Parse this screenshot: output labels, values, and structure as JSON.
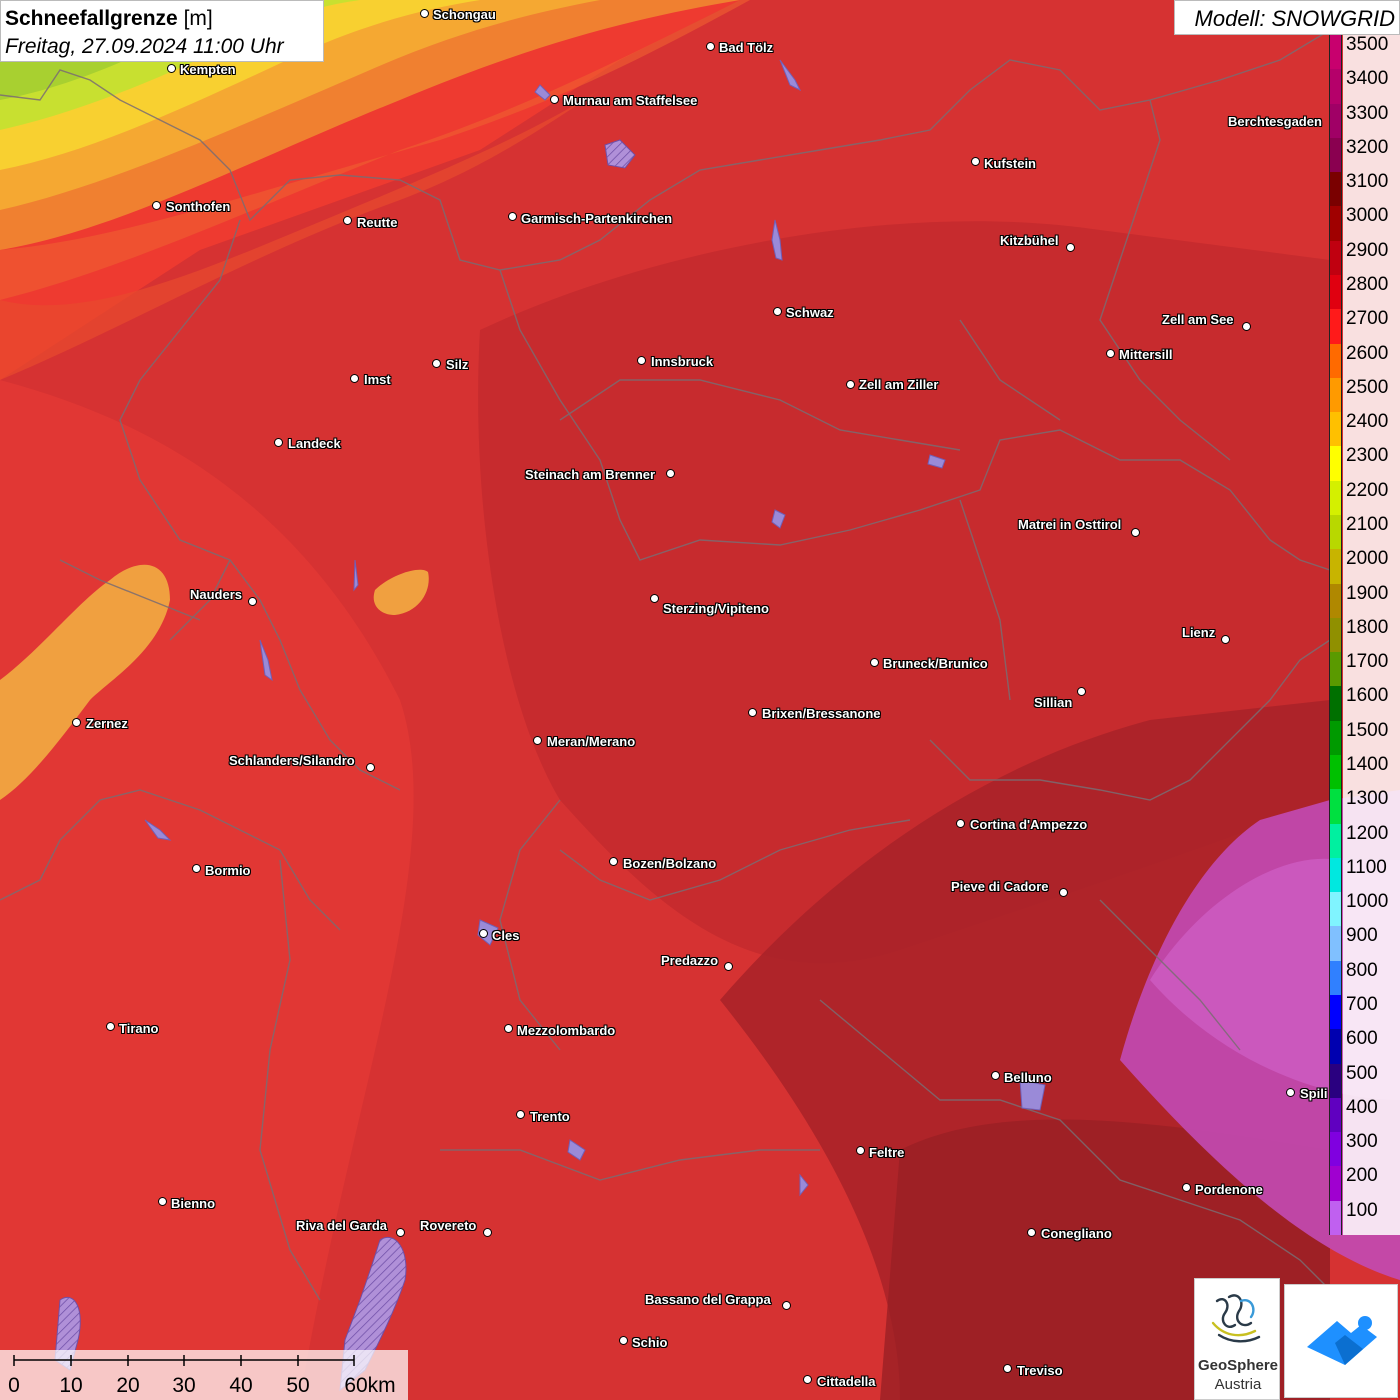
{
  "header": {
    "title": "Schneefallgrenze",
    "unit": "[m]",
    "datetime": "Freitag, 27.09.2024 11:00 Uhr"
  },
  "model": {
    "label": "Modell: SNOWGRID"
  },
  "legend": {
    "levels": [
      {
        "label": "3500",
        "color": "#c8006e"
      },
      {
        "label": "3400",
        "color": "#b5006a"
      },
      {
        "label": "3300",
        "color": "#a00066"
      },
      {
        "label": "3200",
        "color": "#8a0050"
      },
      {
        "label": "3100",
        "color": "#7a0000"
      },
      {
        "label": "3000",
        "color": "#a00000"
      },
      {
        "label": "2900",
        "color": "#c00010"
      },
      {
        "label": "2800",
        "color": "#e00010"
      },
      {
        "label": "2700",
        "color": "#ff1a1a"
      },
      {
        "label": "2600",
        "color": "#ff6a00"
      },
      {
        "label": "2500",
        "color": "#ff9a00"
      },
      {
        "label": "2400",
        "color": "#ffc000"
      },
      {
        "label": "2300",
        "color": "#ffff00"
      },
      {
        "label": "2200",
        "color": "#d4f000"
      },
      {
        "label": "2100",
        "color": "#b8d800"
      },
      {
        "label": "2000",
        "color": "#c8b400"
      },
      {
        "label": "1900",
        "color": "#b08800"
      },
      {
        "label": "1800",
        "color": "#909000"
      },
      {
        "label": "1700",
        "color": "#5a9a00"
      },
      {
        "label": "1600",
        "color": "#007000"
      },
      {
        "label": "1500",
        "color": "#009a00"
      },
      {
        "label": "1400",
        "color": "#00c000"
      },
      {
        "label": "1300",
        "color": "#00e040"
      },
      {
        "label": "1200",
        "color": "#00f0a0"
      },
      {
        "label": "1100",
        "color": "#00e8e0"
      },
      {
        "label": "1000",
        "color": "#80f4ff"
      },
      {
        "label": "900",
        "color": "#80c0ff"
      },
      {
        "label": "800",
        "color": "#3080ff"
      },
      {
        "label": "700",
        "color": "#0000ff"
      },
      {
        "label": "600",
        "color": "#0000b0"
      },
      {
        "label": "500",
        "color": "#2a0080"
      },
      {
        "label": "400",
        "color": "#6000c0"
      },
      {
        "label": "300",
        "color": "#8000e0"
      },
      {
        "label": "200",
        "color": "#a000d0"
      },
      {
        "label": "100",
        "color": "#c060f0"
      }
    ]
  },
  "cities": [
    {
      "name": "Schongau"
    },
    {
      "name": "Kempten"
    },
    {
      "name": "Bad Tölz"
    },
    {
      "name": "Murnau am Staffelsee"
    },
    {
      "name": "Kufstein"
    },
    {
      "name": "Berchtesgaden"
    },
    {
      "name": "Sonthofen"
    },
    {
      "name": "Reutte"
    },
    {
      "name": "Garmisch-Partenkirchen"
    },
    {
      "name": "Kitzbühel"
    },
    {
      "name": "Schwaz"
    },
    {
      "name": "Zell am See"
    },
    {
      "name": "Innsbruck"
    },
    {
      "name": "Mittersill"
    },
    {
      "name": "Imst"
    },
    {
      "name": "Silz"
    },
    {
      "name": "Zell am Ziller"
    },
    {
      "name": "Landeck"
    },
    {
      "name": "Steinach am Brenner"
    },
    {
      "name": "Matrei in Osttirol"
    },
    {
      "name": "Nauders"
    },
    {
      "name": "Sterzing/Vipiteno"
    },
    {
      "name": "Lienz"
    },
    {
      "name": "Bruneck/Brunico"
    },
    {
      "name": "Sillian"
    },
    {
      "name": "Brixen/Bressanone"
    },
    {
      "name": "Zernez"
    },
    {
      "name": "Meran/Merano"
    },
    {
      "name": "Schlanders/Silandro"
    },
    {
      "name": "Cortina d'Ampezzo"
    },
    {
      "name": "Bozen/Bolzano"
    },
    {
      "name": "Bormio"
    },
    {
      "name": "Pieve di Cadore"
    },
    {
      "name": "Cles"
    },
    {
      "name": "Predazzo"
    },
    {
      "name": "Tirano"
    },
    {
      "name": "Mezzolombardo"
    },
    {
      "name": "Belluno"
    },
    {
      "name": "Spili"
    },
    {
      "name": "Trento"
    },
    {
      "name": "Feltre"
    },
    {
      "name": "Pordenone"
    },
    {
      "name": "Bienno"
    },
    {
      "name": "Riva del Garda"
    },
    {
      "name": "Rovereto"
    },
    {
      "name": "Conegliano"
    },
    {
      "name": "Bassano del Grappa"
    },
    {
      "name": "Schio"
    },
    {
      "name": "Treviso"
    },
    {
      "name": "Cittadella"
    }
  ],
  "scale": {
    "labels": [
      "0",
      "10",
      "20",
      "30",
      "40",
      "50",
      "60km"
    ]
  },
  "logos": {
    "geosphere_line1": "GeoSphere",
    "geosphere_line2": "Austria"
  }
}
